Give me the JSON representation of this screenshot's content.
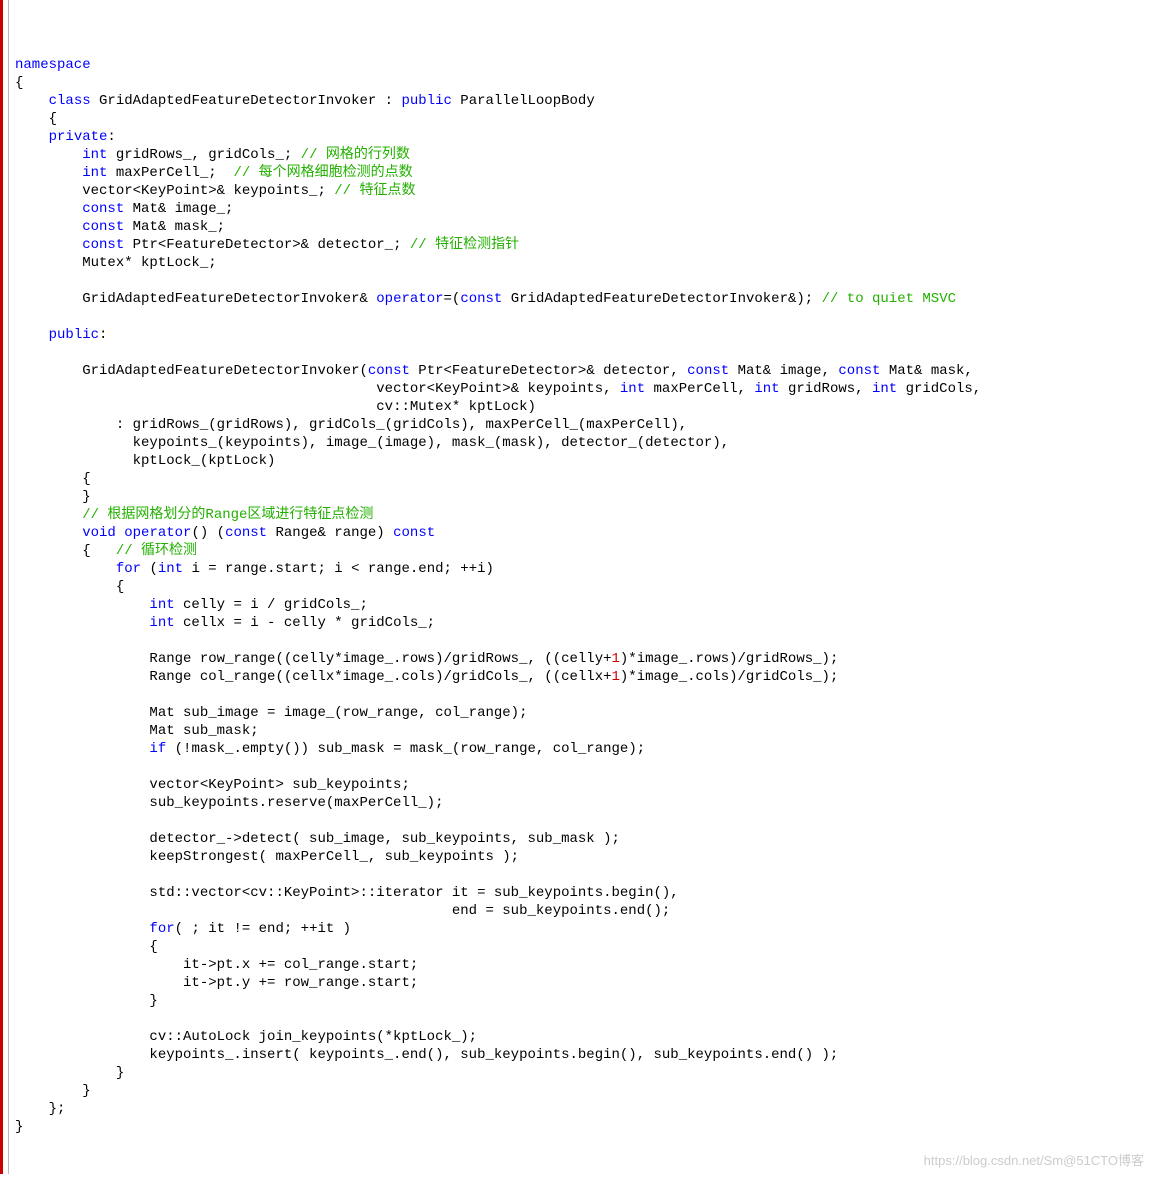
{
  "watermark": "https://blog.csdn.net/Sm@51CTO博客",
  "lines": [
    {
      "indent": 0,
      "tokens": [
        {
          "t": "namespace",
          "c": "kw-blue"
        }
      ]
    },
    {
      "indent": 0,
      "tokens": [
        {
          "t": "{",
          "c": ""
        }
      ]
    },
    {
      "indent": 4,
      "tokens": [
        {
          "t": "class ",
          "c": "kw-blue"
        },
        {
          "t": "GridAdaptedFeatureDetectorInvoker : ",
          "c": ""
        },
        {
          "t": "public ",
          "c": "kw-blue"
        },
        {
          "t": "ParallelLoopBody",
          "c": ""
        }
      ]
    },
    {
      "indent": 4,
      "tokens": [
        {
          "t": "{",
          "c": ""
        }
      ]
    },
    {
      "indent": 4,
      "tokens": [
        {
          "t": "private",
          "c": "kw-blue"
        },
        {
          "t": ":",
          "c": ""
        }
      ]
    },
    {
      "indent": 8,
      "tokens": [
        {
          "t": "int ",
          "c": "kw-blue"
        },
        {
          "t": "gridRows_, gridCols_; ",
          "c": ""
        },
        {
          "t": "// 网格的行列数",
          "c": "comment"
        }
      ]
    },
    {
      "indent": 8,
      "tokens": [
        {
          "t": "int ",
          "c": "kw-blue"
        },
        {
          "t": "maxPerCell_;  ",
          "c": ""
        },
        {
          "t": "// 每个网格细胞检测的点数",
          "c": "comment"
        }
      ]
    },
    {
      "indent": 8,
      "tokens": [
        {
          "t": "vector<KeyPoint>& keypoints_; ",
          "c": ""
        },
        {
          "t": "// 特征点数",
          "c": "comment"
        }
      ]
    },
    {
      "indent": 8,
      "tokens": [
        {
          "t": "const ",
          "c": "kw-blue"
        },
        {
          "t": "Mat& image_;",
          "c": ""
        }
      ]
    },
    {
      "indent": 8,
      "tokens": [
        {
          "t": "const ",
          "c": "kw-blue"
        },
        {
          "t": "Mat& mask_;",
          "c": ""
        }
      ]
    },
    {
      "indent": 8,
      "tokens": [
        {
          "t": "const ",
          "c": "kw-blue"
        },
        {
          "t": "Ptr<FeatureDetector>& detector_; ",
          "c": ""
        },
        {
          "t": "// 特征检测指针",
          "c": "comment"
        }
      ]
    },
    {
      "indent": 8,
      "tokens": [
        {
          "t": "Mutex* kptLock_;",
          "c": ""
        }
      ]
    },
    {
      "indent": 0,
      "tokens": [
        {
          "t": "",
          "c": ""
        }
      ]
    },
    {
      "indent": 8,
      "tokens": [
        {
          "t": "GridAdaptedFeatureDetectorInvoker& ",
          "c": ""
        },
        {
          "t": "operator",
          "c": "kw-blue"
        },
        {
          "t": "=(",
          "c": ""
        },
        {
          "t": "const ",
          "c": "kw-blue"
        },
        {
          "t": "GridAdaptedFeatureDetectorInvoker&); ",
          "c": ""
        },
        {
          "t": "// to quiet MSVC",
          "c": "comment"
        }
      ]
    },
    {
      "indent": 0,
      "tokens": [
        {
          "t": "",
          "c": ""
        }
      ]
    },
    {
      "indent": 4,
      "tokens": [
        {
          "t": "public",
          "c": "kw-blue"
        },
        {
          "t": ":",
          "c": ""
        }
      ]
    },
    {
      "indent": 0,
      "tokens": [
        {
          "t": "",
          "c": ""
        }
      ]
    },
    {
      "indent": 8,
      "tokens": [
        {
          "t": "GridAdaptedFeatureDetectorInvoker(",
          "c": ""
        },
        {
          "t": "const ",
          "c": "kw-blue"
        },
        {
          "t": "Ptr<FeatureDetector>& detector, ",
          "c": ""
        },
        {
          "t": "const ",
          "c": "kw-blue"
        },
        {
          "t": "Mat& image, ",
          "c": ""
        },
        {
          "t": "const ",
          "c": "kw-blue"
        },
        {
          "t": "Mat& mask,",
          "c": ""
        }
      ]
    },
    {
      "indent": 43,
      "tokens": [
        {
          "t": "vector<KeyPoint>& keypoints, ",
          "c": ""
        },
        {
          "t": "int ",
          "c": "kw-blue"
        },
        {
          "t": "maxPerCell, ",
          "c": ""
        },
        {
          "t": "int ",
          "c": "kw-blue"
        },
        {
          "t": "gridRows, ",
          "c": ""
        },
        {
          "t": "int ",
          "c": "kw-blue"
        },
        {
          "t": "gridCols,",
          "c": ""
        }
      ]
    },
    {
      "indent": 43,
      "tokens": [
        {
          "t": "cv::Mutex* kptLock)",
          "c": ""
        }
      ]
    },
    {
      "indent": 12,
      "tokens": [
        {
          "t": ": gridRows_(gridRows), gridCols_(gridCols), maxPerCell_(maxPerCell),",
          "c": ""
        }
      ]
    },
    {
      "indent": 14,
      "tokens": [
        {
          "t": "keypoints_(keypoints), image_(image), mask_(mask), detector_(detector),",
          "c": ""
        }
      ]
    },
    {
      "indent": 14,
      "tokens": [
        {
          "t": "kptLock_(kptLock)",
          "c": ""
        }
      ]
    },
    {
      "indent": 8,
      "tokens": [
        {
          "t": "{",
          "c": ""
        }
      ]
    },
    {
      "indent": 8,
      "tokens": [
        {
          "t": "}",
          "c": ""
        }
      ]
    },
    {
      "indent": 8,
      "tokens": [
        {
          "t": "// 根据网格划分的Range区域进行特征点检测",
          "c": "comment"
        }
      ]
    },
    {
      "indent": 8,
      "tokens": [
        {
          "t": "void ",
          "c": "kw-blue"
        },
        {
          "t": "operator",
          "c": "kw-blue"
        },
        {
          "t": "() (",
          "c": ""
        },
        {
          "t": "const ",
          "c": "kw-blue"
        },
        {
          "t": "Range& range) ",
          "c": ""
        },
        {
          "t": "const",
          "c": "kw-blue"
        }
      ]
    },
    {
      "indent": 8,
      "tokens": [
        {
          "t": "{   ",
          "c": ""
        },
        {
          "t": "// 循环检测",
          "c": "comment"
        }
      ]
    },
    {
      "indent": 12,
      "tokens": [
        {
          "t": "for ",
          "c": "kw-blue"
        },
        {
          "t": "(",
          "c": ""
        },
        {
          "t": "int ",
          "c": "kw-blue"
        },
        {
          "t": "i = range.start; i < range.end; ++i)",
          "c": ""
        }
      ]
    },
    {
      "indent": 12,
      "tokens": [
        {
          "t": "{",
          "c": ""
        }
      ]
    },
    {
      "indent": 16,
      "tokens": [
        {
          "t": "int ",
          "c": "kw-blue"
        },
        {
          "t": "celly = i / gridCols_;",
          "c": ""
        }
      ]
    },
    {
      "indent": 16,
      "tokens": [
        {
          "t": "int ",
          "c": "kw-blue"
        },
        {
          "t": "cellx = i - celly * gridCols_;",
          "c": ""
        }
      ]
    },
    {
      "indent": 0,
      "tokens": [
        {
          "t": "",
          "c": ""
        }
      ]
    },
    {
      "indent": 16,
      "tokens": [
        {
          "t": "Range row_range((celly*image_.rows)/gridRows_, ((celly+",
          "c": ""
        },
        {
          "t": "1",
          "c": "num"
        },
        {
          "t": ")*image_.rows)/gridRows_);",
          "c": ""
        }
      ]
    },
    {
      "indent": 16,
      "tokens": [
        {
          "t": "Range col_range((cellx*image_.cols)/gridCols_, ((cellx+",
          "c": ""
        },
        {
          "t": "1",
          "c": "num"
        },
        {
          "t": ")*image_.cols)/gridCols_);",
          "c": ""
        }
      ]
    },
    {
      "indent": 0,
      "tokens": [
        {
          "t": "",
          "c": ""
        }
      ]
    },
    {
      "indent": 16,
      "tokens": [
        {
          "t": "Mat sub_image = image_(row_range, col_range);",
          "c": ""
        }
      ]
    },
    {
      "indent": 16,
      "tokens": [
        {
          "t": "Mat sub_mask;",
          "c": ""
        }
      ]
    },
    {
      "indent": 16,
      "tokens": [
        {
          "t": "if ",
          "c": "kw-blue"
        },
        {
          "t": "(!mask_.empty()) sub_mask = mask_(row_range, col_range);",
          "c": ""
        }
      ]
    },
    {
      "indent": 0,
      "tokens": [
        {
          "t": "",
          "c": ""
        }
      ]
    },
    {
      "indent": 16,
      "tokens": [
        {
          "t": "vector<KeyPoint> sub_keypoints;",
          "c": ""
        }
      ]
    },
    {
      "indent": 16,
      "tokens": [
        {
          "t": "sub_keypoints.reserve(maxPerCell_);",
          "c": ""
        }
      ]
    },
    {
      "indent": 0,
      "tokens": [
        {
          "t": "",
          "c": ""
        }
      ]
    },
    {
      "indent": 16,
      "tokens": [
        {
          "t": "detector_->detect( sub_image, sub_keypoints, sub_mask );",
          "c": ""
        }
      ]
    },
    {
      "indent": 16,
      "tokens": [
        {
          "t": "keepStrongest( maxPerCell_, sub_keypoints );",
          "c": ""
        }
      ]
    },
    {
      "indent": 0,
      "tokens": [
        {
          "t": "",
          "c": ""
        }
      ]
    },
    {
      "indent": 16,
      "tokens": [
        {
          "t": "std::vector<cv::KeyPoint>::iterator it = sub_keypoints.begin(),",
          "c": ""
        }
      ]
    },
    {
      "indent": 52,
      "tokens": [
        {
          "t": "end = sub_keypoints.end();",
          "c": ""
        }
      ]
    },
    {
      "indent": 16,
      "tokens": [
        {
          "t": "for",
          "c": "kw-blue"
        },
        {
          "t": "( ; it != end; ++it )",
          "c": ""
        }
      ]
    },
    {
      "indent": 16,
      "tokens": [
        {
          "t": "{",
          "c": ""
        }
      ]
    },
    {
      "indent": 20,
      "tokens": [
        {
          "t": "it->pt.x += col_range.start;",
          "c": ""
        }
      ]
    },
    {
      "indent": 20,
      "tokens": [
        {
          "t": "it->pt.y += row_range.start;",
          "c": ""
        }
      ]
    },
    {
      "indent": 16,
      "tokens": [
        {
          "t": "}",
          "c": ""
        }
      ]
    },
    {
      "indent": 0,
      "tokens": [
        {
          "t": "",
          "c": ""
        }
      ]
    },
    {
      "indent": 16,
      "tokens": [
        {
          "t": "cv::AutoLock join_keypoints(*kptLock_);",
          "c": ""
        }
      ]
    },
    {
      "indent": 16,
      "tokens": [
        {
          "t": "keypoints_.insert( keypoints_.end(), sub_keypoints.begin(), sub_keypoints.end() );",
          "c": ""
        }
      ]
    },
    {
      "indent": 12,
      "tokens": [
        {
          "t": "}",
          "c": ""
        }
      ]
    },
    {
      "indent": 8,
      "tokens": [
        {
          "t": "}",
          "c": ""
        }
      ]
    },
    {
      "indent": 4,
      "tokens": [
        {
          "t": "};",
          "c": ""
        }
      ]
    },
    {
      "indent": 0,
      "tokens": [
        {
          "t": "}",
          "c": ""
        }
      ]
    }
  ]
}
